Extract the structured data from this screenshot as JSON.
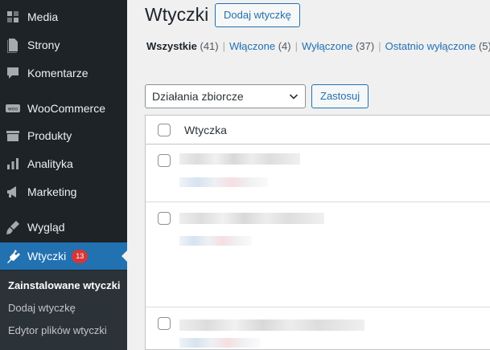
{
  "sidebar": {
    "items": [
      {
        "label": "Media",
        "icon": "media-icon"
      },
      {
        "label": "Strony",
        "icon": "pages-icon"
      },
      {
        "label": "Komentarze",
        "icon": "comments-icon"
      },
      {
        "label": "WooCommerce",
        "icon": "woocommerce-icon"
      },
      {
        "label": "Produkty",
        "icon": "products-icon"
      },
      {
        "label": "Analityka",
        "icon": "analytics-icon"
      },
      {
        "label": "Marketing",
        "icon": "marketing-icon"
      },
      {
        "label": "Wygląd",
        "icon": "appearance-icon"
      },
      {
        "label": "Wtyczki",
        "icon": "plugins-icon",
        "badge": "13",
        "active": true
      }
    ],
    "submenu": [
      {
        "label": "Zainstalowane wtyczki",
        "current": true
      },
      {
        "label": "Dodaj wtyczkę"
      },
      {
        "label": "Edytor plików wtyczki"
      }
    ]
  },
  "header": {
    "title": "Wtyczki",
    "add_button": "Dodaj wtyczkę"
  },
  "filters": [
    {
      "label": "Wszystkie",
      "count": "(41)",
      "current": true
    },
    {
      "label": "Włączone",
      "count": "(4)"
    },
    {
      "label": "Wyłączone",
      "count": "(37)"
    },
    {
      "label": "Ostatnio wyłączone",
      "count": "(5)"
    }
  ],
  "bulk_actions": {
    "selected": "Działania zbiorcze",
    "apply": "Zastosuj"
  },
  "table": {
    "column_header": "Wtyczka"
  },
  "colors": {
    "sidebar_bg": "#1d2327",
    "accent": "#2271b1",
    "badge": "#d63638"
  }
}
